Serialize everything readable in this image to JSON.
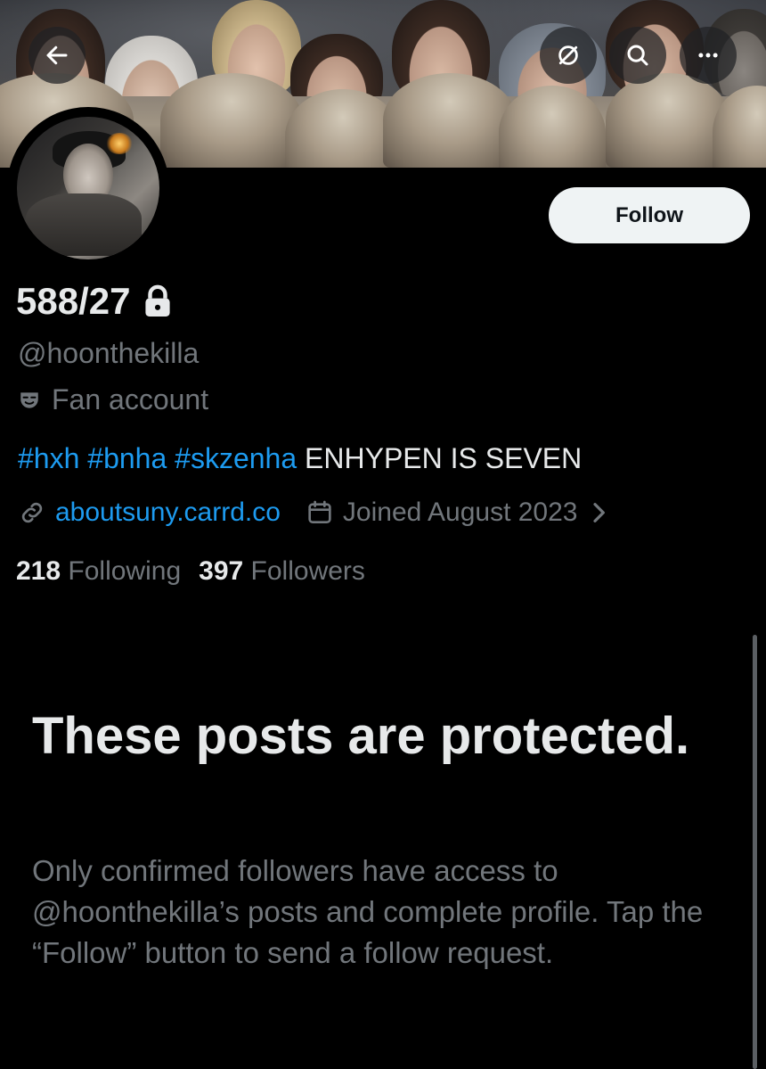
{
  "header": {
    "back_icon": "arrow-left-icon",
    "stop_icon": "slashed-circle-icon",
    "search_icon": "search-icon",
    "more_icon": "more-horizontal-icon",
    "more_label": "•••"
  },
  "profile": {
    "display_name": "588/27",
    "protected_icon": "lock-icon",
    "handle": "@hoonthekilla",
    "category_icon": "mask-icon",
    "category": "Fan account",
    "bio_tags": [
      "#hxh",
      "#bnha",
      "#skzenha"
    ],
    "bio_text": "ENHYPEN IS SEVEN",
    "link_icon": "link-icon",
    "website": "aboutsuny.carrd.co",
    "calendar_icon": "calendar-icon",
    "joined": "Joined August 2023",
    "chevron_icon": "chevron-right-icon",
    "following_count": "218",
    "following_label": "Following",
    "followers_count": "397",
    "followers_label": "Followers"
  },
  "actions": {
    "follow_label": "Follow"
  },
  "protected_notice": {
    "title": "These posts are protected.",
    "description": "Only confirmed followers have access to @hoonthekilla’s posts and complete profile. Tap the “Follow” button to send a follow request."
  },
  "colors": {
    "background": "#000000",
    "text_primary": "#e7e9ea",
    "text_secondary": "#71767b",
    "accent": "#1d9bf0",
    "button_bg": "#eff3f4"
  }
}
